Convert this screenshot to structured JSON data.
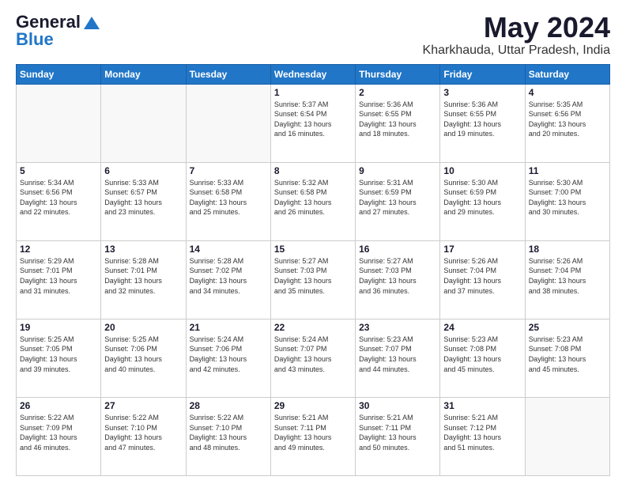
{
  "header": {
    "logo_general": "General",
    "logo_blue": "Blue",
    "title": "May 2024",
    "location": "Kharkhauda, Uttar Pradesh, India"
  },
  "days_of_week": [
    "Sunday",
    "Monday",
    "Tuesday",
    "Wednesday",
    "Thursday",
    "Friday",
    "Saturday"
  ],
  "weeks": [
    [
      {
        "day": "",
        "info": ""
      },
      {
        "day": "",
        "info": ""
      },
      {
        "day": "",
        "info": ""
      },
      {
        "day": "1",
        "info": "Sunrise: 5:37 AM\nSunset: 6:54 PM\nDaylight: 13 hours\nand 16 minutes."
      },
      {
        "day": "2",
        "info": "Sunrise: 5:36 AM\nSunset: 6:55 PM\nDaylight: 13 hours\nand 18 minutes."
      },
      {
        "day": "3",
        "info": "Sunrise: 5:36 AM\nSunset: 6:55 PM\nDaylight: 13 hours\nand 19 minutes."
      },
      {
        "day": "4",
        "info": "Sunrise: 5:35 AM\nSunset: 6:56 PM\nDaylight: 13 hours\nand 20 minutes."
      }
    ],
    [
      {
        "day": "5",
        "info": "Sunrise: 5:34 AM\nSunset: 6:56 PM\nDaylight: 13 hours\nand 22 minutes."
      },
      {
        "day": "6",
        "info": "Sunrise: 5:33 AM\nSunset: 6:57 PM\nDaylight: 13 hours\nand 23 minutes."
      },
      {
        "day": "7",
        "info": "Sunrise: 5:33 AM\nSunset: 6:58 PM\nDaylight: 13 hours\nand 25 minutes."
      },
      {
        "day": "8",
        "info": "Sunrise: 5:32 AM\nSunset: 6:58 PM\nDaylight: 13 hours\nand 26 minutes."
      },
      {
        "day": "9",
        "info": "Sunrise: 5:31 AM\nSunset: 6:59 PM\nDaylight: 13 hours\nand 27 minutes."
      },
      {
        "day": "10",
        "info": "Sunrise: 5:30 AM\nSunset: 6:59 PM\nDaylight: 13 hours\nand 29 minutes."
      },
      {
        "day": "11",
        "info": "Sunrise: 5:30 AM\nSunset: 7:00 PM\nDaylight: 13 hours\nand 30 minutes."
      }
    ],
    [
      {
        "day": "12",
        "info": "Sunrise: 5:29 AM\nSunset: 7:01 PM\nDaylight: 13 hours\nand 31 minutes."
      },
      {
        "day": "13",
        "info": "Sunrise: 5:28 AM\nSunset: 7:01 PM\nDaylight: 13 hours\nand 32 minutes."
      },
      {
        "day": "14",
        "info": "Sunrise: 5:28 AM\nSunset: 7:02 PM\nDaylight: 13 hours\nand 34 minutes."
      },
      {
        "day": "15",
        "info": "Sunrise: 5:27 AM\nSunset: 7:03 PM\nDaylight: 13 hours\nand 35 minutes."
      },
      {
        "day": "16",
        "info": "Sunrise: 5:27 AM\nSunset: 7:03 PM\nDaylight: 13 hours\nand 36 minutes."
      },
      {
        "day": "17",
        "info": "Sunrise: 5:26 AM\nSunset: 7:04 PM\nDaylight: 13 hours\nand 37 minutes."
      },
      {
        "day": "18",
        "info": "Sunrise: 5:26 AM\nSunset: 7:04 PM\nDaylight: 13 hours\nand 38 minutes."
      }
    ],
    [
      {
        "day": "19",
        "info": "Sunrise: 5:25 AM\nSunset: 7:05 PM\nDaylight: 13 hours\nand 39 minutes."
      },
      {
        "day": "20",
        "info": "Sunrise: 5:25 AM\nSunset: 7:06 PM\nDaylight: 13 hours\nand 40 minutes."
      },
      {
        "day": "21",
        "info": "Sunrise: 5:24 AM\nSunset: 7:06 PM\nDaylight: 13 hours\nand 42 minutes."
      },
      {
        "day": "22",
        "info": "Sunrise: 5:24 AM\nSunset: 7:07 PM\nDaylight: 13 hours\nand 43 minutes."
      },
      {
        "day": "23",
        "info": "Sunrise: 5:23 AM\nSunset: 7:07 PM\nDaylight: 13 hours\nand 44 minutes."
      },
      {
        "day": "24",
        "info": "Sunrise: 5:23 AM\nSunset: 7:08 PM\nDaylight: 13 hours\nand 45 minutes."
      },
      {
        "day": "25",
        "info": "Sunrise: 5:23 AM\nSunset: 7:08 PM\nDaylight: 13 hours\nand 45 minutes."
      }
    ],
    [
      {
        "day": "26",
        "info": "Sunrise: 5:22 AM\nSunset: 7:09 PM\nDaylight: 13 hours\nand 46 minutes."
      },
      {
        "day": "27",
        "info": "Sunrise: 5:22 AM\nSunset: 7:10 PM\nDaylight: 13 hours\nand 47 minutes."
      },
      {
        "day": "28",
        "info": "Sunrise: 5:22 AM\nSunset: 7:10 PM\nDaylight: 13 hours\nand 48 minutes."
      },
      {
        "day": "29",
        "info": "Sunrise: 5:21 AM\nSunset: 7:11 PM\nDaylight: 13 hours\nand 49 minutes."
      },
      {
        "day": "30",
        "info": "Sunrise: 5:21 AM\nSunset: 7:11 PM\nDaylight: 13 hours\nand 50 minutes."
      },
      {
        "day": "31",
        "info": "Sunrise: 5:21 AM\nSunset: 7:12 PM\nDaylight: 13 hours\nand 51 minutes."
      },
      {
        "day": "",
        "info": ""
      }
    ]
  ]
}
